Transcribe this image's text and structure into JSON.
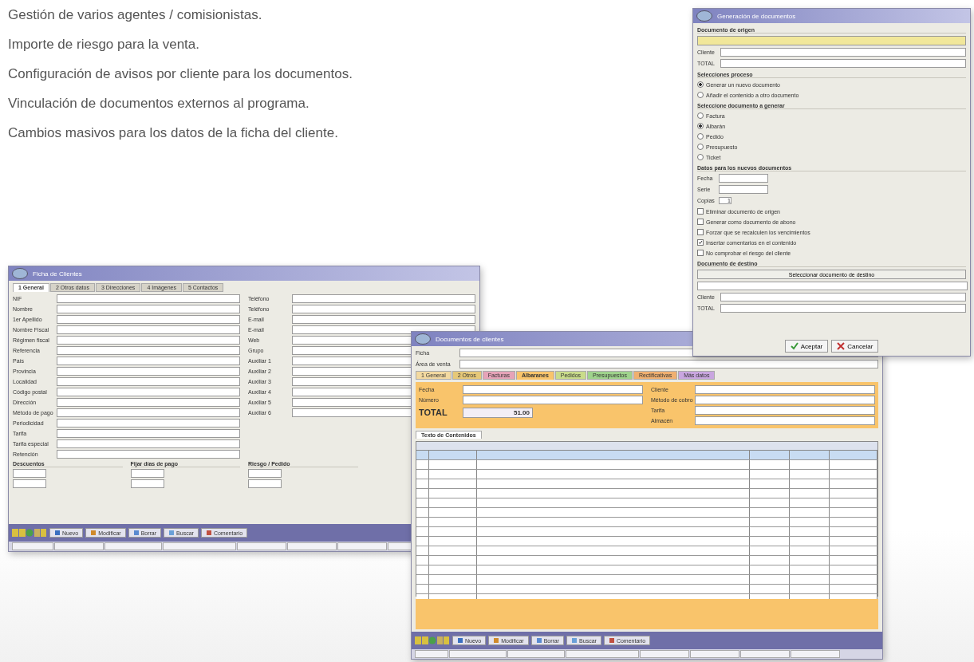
{
  "features": [
    "Gestión de varios agentes / comisionistas.",
    "Importe de riesgo para la venta.",
    "Configuración de avisos por cliente para los documentos.",
    "Vinculación de documentos externos al programa.",
    "Cambios masivos para los datos de la ficha del cliente."
  ],
  "customer_window": {
    "title": "Ficha de Clientes",
    "tabs": [
      {
        "label": "1 General",
        "selected": true
      },
      {
        "label": "2 Otros datos",
        "selected": false
      },
      {
        "label": "3 Direcciones",
        "selected": false
      },
      {
        "label": "4 Imágenes",
        "selected": false
      },
      {
        "label": "5 Contactos",
        "selected": false
      }
    ],
    "left_fields": [
      "NIF",
      "Nombre",
      "1er Apellido",
      "Nombre Fiscal",
      "Régimen fiscal",
      "Referencia",
      "País",
      "Provincia",
      "Localidad",
      "Código postal",
      "Dirección",
      "Método de pago",
      "Periodicidad",
      "Tarifa",
      "Tarifa especial",
      "Retención"
    ],
    "right_fields": [
      "Teléfono",
      "Teléfono",
      "E-mail",
      "E-mail",
      "Web",
      "Grupo",
      "Auxiliar 1",
      "Auxiliar 2",
      "Auxiliar 3",
      "Auxiliar 4",
      "Auxiliar 5",
      "Auxiliar 6"
    ],
    "groups": [
      "Descuentos",
      "Fijar días de pago",
      "Riesgo / Pedido"
    ],
    "toolbar": [
      "Nuevo",
      "Modificar",
      "Borrar",
      "Buscar",
      "Comentario"
    ]
  },
  "documents_window": {
    "title": "Documentos de clientes",
    "header_fields": [
      "Ficha",
      "Área de venta"
    ],
    "tabs": [
      {
        "label": "1 General",
        "selected": false,
        "color": "#f3d9a0"
      },
      {
        "label": "2 Otros",
        "selected": false,
        "color": "#e6c878"
      },
      {
        "label": "Facturas",
        "selected": false,
        "color": "#e6a3b8"
      },
      {
        "label": "Albaranes",
        "selected": true,
        "color": "#f9c46b"
      },
      {
        "label": "Pedidos",
        "selected": false,
        "color": "#c9dc8a"
      },
      {
        "label": "Presupuestos",
        "selected": false,
        "color": "#9fd38c"
      },
      {
        "label": "Rectificativas",
        "selected": false,
        "color": "#f0b070"
      },
      {
        "label": "Más datos",
        "selected": false,
        "color": "#c9a6e0"
      }
    ],
    "left_fields": [
      "Fecha",
      "Número"
    ],
    "total_label": "TOTAL",
    "total_value": "51.00",
    "right_fields": [
      "Cliente",
      "Método de cobro",
      "Tarifa",
      "Almacén"
    ],
    "contents_tab": "Texto de Contenidos",
    "rows": [
      {
        "selected": true
      },
      {
        "selected": false
      },
      {
        "selected": false
      },
      {
        "selected": false
      },
      {
        "selected": false
      },
      {
        "selected": false
      },
      {
        "selected": false
      },
      {
        "selected": false
      },
      {
        "selected": false
      },
      {
        "selected": false
      },
      {
        "selected": false
      },
      {
        "selected": false
      },
      {
        "selected": false
      },
      {
        "selected": false
      },
      {
        "selected": false
      },
      {
        "selected": false
      }
    ],
    "toolbar": [
      "Nuevo",
      "Modificar",
      "Borrar",
      "Buscar",
      "Comentario"
    ]
  },
  "generator_dialog": {
    "title": "Generación de documentos",
    "sections": [
      {
        "kind": "source",
        "title": "Documento de origen",
        "fields": [
          "Cliente",
          "TOTAL"
        ]
      },
      {
        "kind": "radio",
        "title": "Selecciones proceso",
        "items": [
          {
            "label": "Generar un nuevo documento",
            "selected": true
          },
          {
            "label": "Añadir el contenido a otro documento",
            "selected": false
          }
        ]
      },
      {
        "kind": "radio",
        "title": "Seleccione documento a generar",
        "items": [
          {
            "label": "Factura",
            "selected": false
          },
          {
            "label": "Albarán",
            "selected": true
          },
          {
            "label": "Pedido",
            "selected": false
          },
          {
            "label": "Presupuesto",
            "selected": false
          },
          {
            "label": "Ticket",
            "selected": false
          }
        ]
      },
      {
        "kind": "data",
        "title": "Datos para los nuevos documentos",
        "fields": [
          "Fecha",
          "Serie",
          "Copias"
        ],
        "copies": "1"
      },
      {
        "kind": "check",
        "items": [
          {
            "label": "Eliminar documento de origen",
            "checked": false
          },
          {
            "label": "Generar como documento de abono",
            "checked": false
          },
          {
            "label": "Forzar que se recalculen los vencimientos",
            "checked": false
          },
          {
            "label": "Insertar comentarios en el contenido",
            "checked": true
          },
          {
            "label": "No comprobar el riesgo del cliente",
            "checked": false
          }
        ]
      },
      {
        "kind": "target",
        "title": "Documento de destino",
        "button": "Seleccionar documento de destino",
        "fields": [
          "Cliente",
          "TOTAL"
        ]
      }
    ],
    "buttons": [
      {
        "kind": "ok",
        "label": "Aceptar"
      },
      {
        "kind": "cancel",
        "label": "Cancelar"
      }
    ]
  }
}
